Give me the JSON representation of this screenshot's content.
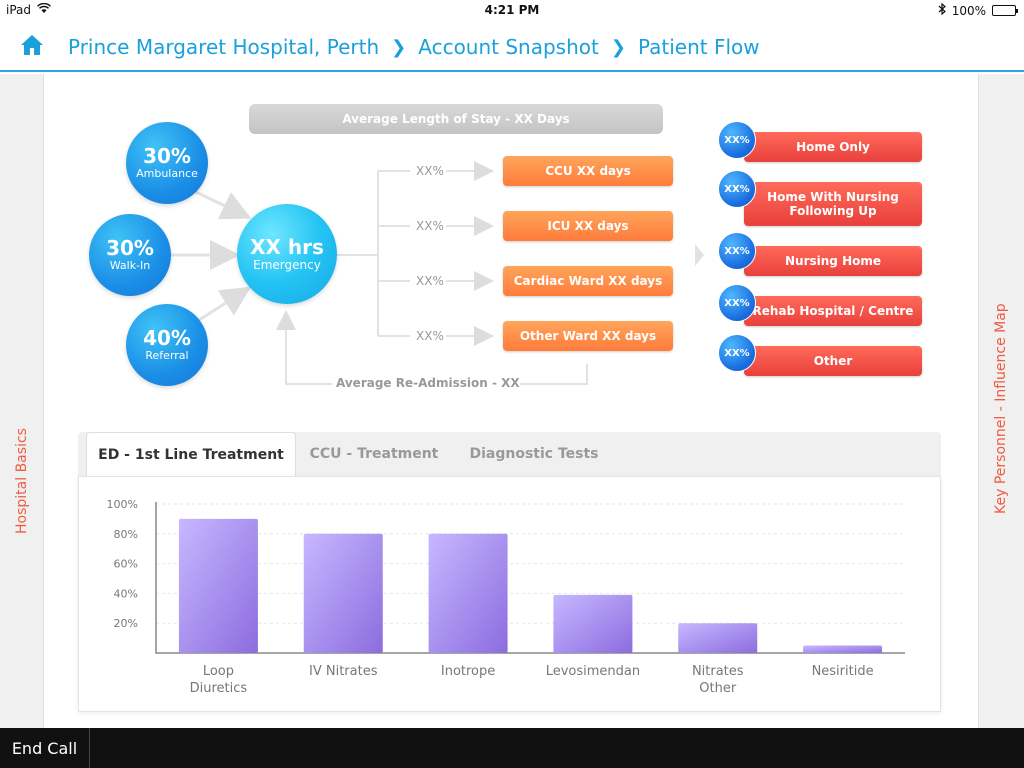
{
  "status_bar": {
    "device": "iPad",
    "time": "4:21 PM",
    "battery": "100%"
  },
  "nav": {
    "breadcrumbs": [
      "Prince Margaret Hospital, Perth",
      "Account Snapshot",
      "Patient Flow"
    ]
  },
  "side": {
    "left_label": "Hospital Basics",
    "right_label": "Key Personnel - Influence Map"
  },
  "flow": {
    "stay_bar": "Average Length of Stay - XX Days",
    "inputs": [
      {
        "pct": "30%",
        "label": "Ambulance"
      },
      {
        "pct": "30%",
        "label": "Walk-In"
      },
      {
        "pct": "40%",
        "label": "Referral"
      }
    ],
    "emergency": {
      "value": "XX hrs",
      "label": "Emergency"
    },
    "wards": [
      {
        "pct": "XX%",
        "label": "CCU XX days"
      },
      {
        "pct": "XX%",
        "label": "ICU XX days"
      },
      {
        "pct": "XX%",
        "label": "Cardiac Ward XX days"
      },
      {
        "pct": "XX%",
        "label": "Other Ward XX days"
      }
    ],
    "readmission": "Average Re-Admission - XX",
    "outcomes": [
      {
        "badge": "XX%",
        "label": "Home Only"
      },
      {
        "badge": "XX%",
        "label": "Home With Nursing Following Up"
      },
      {
        "badge": "XX%",
        "label": "Nursing Home"
      },
      {
        "badge": "XX%",
        "label": "Rehab Hospital / Centre"
      },
      {
        "badge": "XX%",
        "label": "Other"
      }
    ]
  },
  "tabs": [
    {
      "label": "ED - 1st Line Treatment",
      "active": true
    },
    {
      "label": "CCU - Treatment",
      "active": false
    },
    {
      "label": "Diagnostic Tests",
      "active": false
    }
  ],
  "chart_data": {
    "type": "bar",
    "categories": [
      "Loop\nDiuretics",
      "IV Nitrates",
      "Inotrope",
      "Levosimendan",
      "Nitrates\nOther",
      "Nesiritide"
    ],
    "values": [
      90,
      80,
      80,
      39,
      20,
      5
    ],
    "yticks": [
      "100%",
      "80%",
      "60%",
      "40%",
      "20%"
    ],
    "ylim": [
      0,
      100
    ],
    "grid": true
  },
  "footer": {
    "end_call": "End Call"
  },
  "colors": {
    "accent": "#1aa0dc",
    "side_label": "#f15a3f",
    "ward": "#ff7b3c",
    "outcome": "#e8403b"
  }
}
